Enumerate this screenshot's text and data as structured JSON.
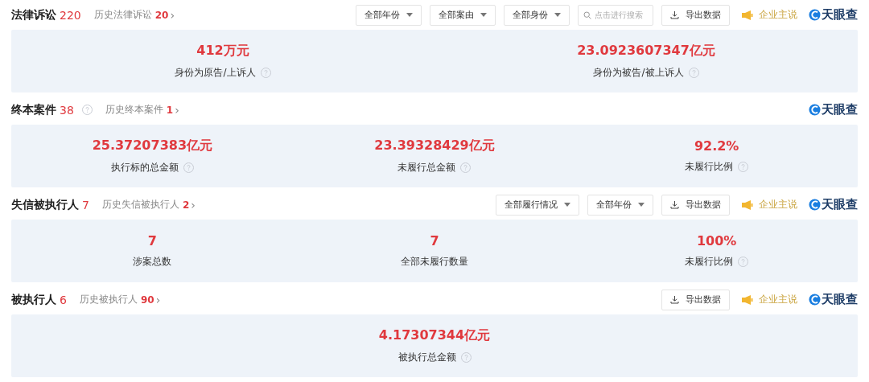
{
  "sections": [
    {
      "title": "法律诉讼",
      "count": "220",
      "help": false,
      "history_label": "历史法律诉讼",
      "history_count": "20",
      "history_arrow": "›",
      "controls": [
        {
          "kind": "dropdown",
          "label": "全部年份"
        },
        {
          "kind": "dropdown",
          "label": "全部案由"
        },
        {
          "kind": "dropdown",
          "label": "全部身份"
        },
        {
          "kind": "search",
          "placeholder": "点击进行搜索"
        },
        {
          "kind": "export",
          "label": "导出数据"
        },
        {
          "kind": "promo",
          "label": "企业主说"
        },
        {
          "kind": "logo",
          "label": "天眼查"
        }
      ],
      "stats": [
        {
          "value": "412万元",
          "label": "身份为原告/上诉人",
          "help": true
        },
        {
          "value": "23.0923607347亿元",
          "label": "身份为被告/被上诉人",
          "help": true
        }
      ]
    },
    {
      "title": "终本案件",
      "count": "38",
      "help": true,
      "history_label": "历史终本案件",
      "history_count": "1",
      "history_arrow": "›",
      "controls": [
        {
          "kind": "logo",
          "label": "天眼查"
        }
      ],
      "stats": [
        {
          "value": "25.37207383亿元",
          "label": "执行标的总金额",
          "help": true
        },
        {
          "value": "23.39328429亿元",
          "label": "未履行总金额",
          "help": true
        },
        {
          "value": "92.2%",
          "label": "未履行比例",
          "help": true
        }
      ]
    },
    {
      "title": "失信被执行人",
      "count": "7",
      "help": false,
      "history_label": "历史失信被执行人",
      "history_count": "2",
      "history_arrow": "›",
      "controls": [
        {
          "kind": "dropdown",
          "label": "全部履行情况"
        },
        {
          "kind": "dropdown",
          "label": "全部年份"
        },
        {
          "kind": "export",
          "label": "导出数据"
        },
        {
          "kind": "promo",
          "label": "企业主说"
        },
        {
          "kind": "logo",
          "label": "天眼查"
        }
      ],
      "stats": [
        {
          "value": "7",
          "label": "涉案总数",
          "help": false
        },
        {
          "value": "7",
          "label": "全部未履行数量",
          "help": false
        },
        {
          "value": "100%",
          "label": "未履行比例",
          "help": true
        }
      ]
    },
    {
      "title": "被执行人",
      "count": "6",
      "help": false,
      "history_label": "历史被执行人",
      "history_count": "90",
      "history_arrow": "›",
      "controls": [
        {
          "kind": "export",
          "label": "导出数据"
        },
        {
          "kind": "promo",
          "label": "企业主说"
        },
        {
          "kind": "logo",
          "label": "天眼查"
        }
      ],
      "stats": [
        {
          "value": "4.17307344亿元",
          "label": "被执行总金额",
          "help": true
        }
      ]
    }
  ]
}
